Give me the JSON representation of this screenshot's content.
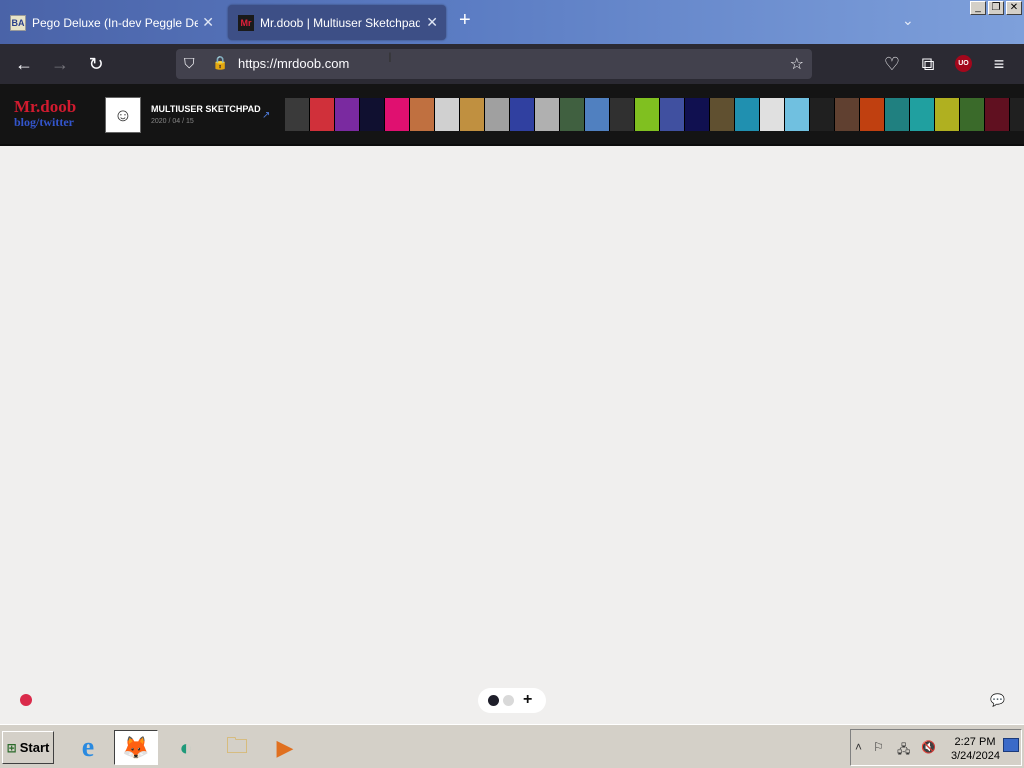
{
  "browser": {
    "tabs": [
      {
        "title": "Pego Deluxe (In-dev Peggle Deluxe",
        "favicon": "BA",
        "active": false,
        "close_label": "✕"
      },
      {
        "title": "Mr.doob | Multiuser Sketchpad",
        "favicon": "Mr",
        "active": true,
        "close_label": "✕"
      }
    ],
    "new_tab_label": "+",
    "tab_list_label": "⌄",
    "url": "https://mrdoob.com",
    "window_controls": [
      "_",
      "❐",
      "✕"
    ],
    "icons": {
      "back": "←",
      "forward": "→",
      "reload": "↻",
      "shield": "⛉",
      "lock": "🔒",
      "star": "☆",
      "pocket": "♡",
      "extensions": "⧉",
      "ublock": "UO",
      "menu": "≡"
    }
  },
  "site": {
    "logo_line1": "Mr.doob",
    "logo_line2": "blog/twitter",
    "project_title": "MULTIUSER SKETCHPAD",
    "project_date": "2020 / 04 / 15",
    "external_link_icon": "↗",
    "thumbnail_colors": [
      "#3a3a3a",
      "#d0303a",
      "#7a2aa0",
      "#101030",
      "#e01070",
      "#c07040",
      "#d0d0d0",
      "#c09040",
      "#a0a0a0",
      "#3040a0",
      "#b0b0b0",
      "#406040",
      "#5080c0",
      "#303030",
      "#80c020",
      "#4050a0",
      "#101050",
      "#605030",
      "#2090b0",
      "#e0e0e0",
      "#70c0e0",
      "#202020",
      "#604030",
      "#c04010",
      "#208080",
      "#20a0a0",
      "#b0b020",
      "#3a6a2a",
      "#601020",
      "#202020"
    ]
  },
  "canvas": {
    "brush_color": "#da2a4a",
    "pill": {
      "add_label": "+"
    },
    "chat_icon": "💬"
  },
  "taskbar": {
    "start_label": "Start",
    "apps": [
      "internet-explorer",
      "firefox",
      "edge",
      "file-explorer",
      "media-player"
    ],
    "app_icons": {
      "internet-explorer": "e",
      "firefox": "🦊",
      "edge": "◐",
      "file-explorer": "🗀",
      "media-player": "▶"
    },
    "tray": {
      "time": "2:27 PM",
      "date": "3/24/2024",
      "chevron": "˄",
      "flag": "⚐",
      "network": "🖧",
      "volume": "🔇"
    }
  }
}
